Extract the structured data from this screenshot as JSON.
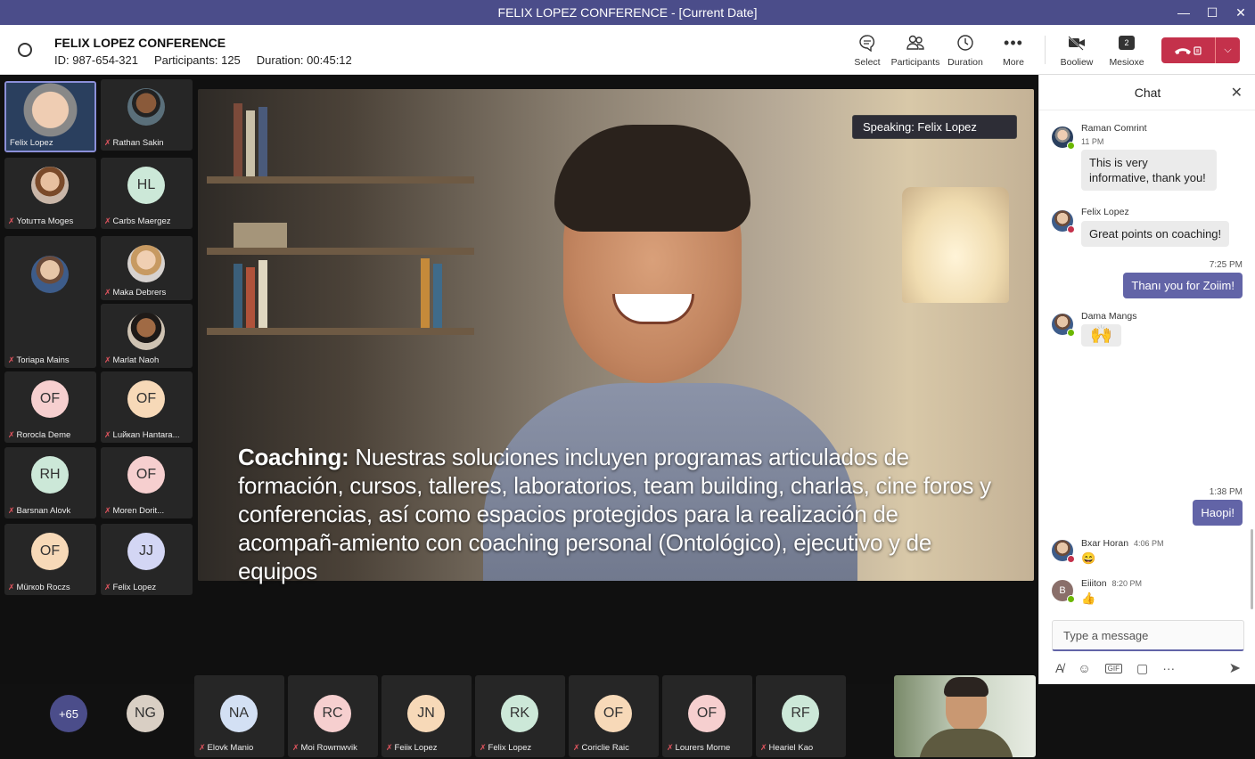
{
  "window": {
    "title": "FELIX LOPEZ CONFERENCE - [Current Date]"
  },
  "meeting": {
    "title": "FELIX LOPEZ CONFERENCE",
    "id": "ID: 987-654-321",
    "participants": "Participants: 125",
    "duration": "Duration: 00:45:12"
  },
  "toolbar": {
    "select": "Select",
    "participants": "Participants",
    "duration": "Duration",
    "more": "More",
    "booliew": "Booliew",
    "mesioxe": "Mesioxe",
    "mesioxe_badge": "2"
  },
  "speaking": "Speaking: Felix Lopez",
  "caption": {
    "lead": "Coaching:",
    "text": " Nuestras soluciones incluyen programas articulados de formación, cursos, talleres, laboratorios, team building, charlas, cine foros y conferencias, así como espacios protegidos para la realización de acompañ-amiento con coaching personal (Ontológico), ejecutivo y de equipos"
  },
  "grid": [
    {
      "name": "Felix Lopez",
      "initials": "",
      "color": "",
      "photo": "photo-av6"
    },
    {
      "name": "Rathan Sakin",
      "initials": "",
      "color": "",
      "photo": "photo-av2"
    },
    {
      "name": "Yotuтта Moges",
      "initials": "",
      "color": "",
      "photo": "photo-av3"
    },
    {
      "name": "Carbs Maergez",
      "initials": "HL",
      "color": "#cce8d8",
      "photo": ""
    },
    {
      "name": "Toriapa Mains",
      "initials": "",
      "color": "",
      "photo": "photo-av"
    },
    {
      "name": "Maka Debrers",
      "initials": "",
      "color": "",
      "photo": "photo-av4"
    },
    {
      "name": "Marlat Naoh",
      "initials": "",
      "color": "",
      "photo": "photo-av5"
    },
    {
      "name": "Rorocla Deme",
      "initials": "OF",
      "color": "#f6cfcf",
      "photo": ""
    },
    {
      "name": "Luйкan Hantara...",
      "initials": "OF",
      "color": "#f7d9b8",
      "photo": ""
    },
    {
      "name": "Barsnan Alovk",
      "initials": "RH",
      "color": "#cce8d8",
      "photo": ""
    },
    {
      "name": "Moren Dorit...",
      "initials": "OF",
      "color": "#f6cfcf",
      "photo": ""
    },
    {
      "name": "Mürкob Roczs",
      "initials": "OF",
      "color": "#f7d9b8",
      "photo": ""
    },
    {
      "name": "Felix Lopez",
      "initials": "JJ",
      "color": "#d3d6f4",
      "photo": ""
    }
  ],
  "bottom": {
    "more_count": "+65",
    "ng": "NG",
    "tiles": [
      {
        "name": "Elovk Manio",
        "initials": "NA",
        "color": "#d3e0f4"
      },
      {
        "name": "Moi Rowmwvik",
        "initials": "RC",
        "color": "#f6cfcf"
      },
      {
        "name": "Feiiк Lopez",
        "initials": "JN",
        "color": "#f7d9b8"
      },
      {
        "name": "Felix Lopez",
        "initials": "RK",
        "color": "#cce8d8"
      },
      {
        "name": "Coriclie Raic",
        "initials": "OF",
        "color": "#f7d9b8"
      },
      {
        "name": "Lourers Morne",
        "initials": "OF",
        "color": "#f6cfcf"
      },
      {
        "name": "Heariel Kao",
        "initials": "RF",
        "color": "#cce8d8"
      }
    ]
  },
  "chat": {
    "title": "Chat",
    "messages": [
      {
        "name": "Raman Comrint",
        "time": "11 PM",
        "text": "This is very informative, thank you!"
      },
      {
        "name": "Felix Lopez",
        "text": "Great points on coaching!"
      },
      {
        "time": "7:25 PM",
        "text": "Thanı you for Zoiim!"
      },
      {
        "name": "Dama Mangs",
        "text": "🙌"
      },
      {
        "time": "1:38 PM",
        "text": "Haopi!"
      },
      {
        "name": "Bxar Horan",
        "time": "4:06 PM",
        "text": "😄"
      },
      {
        "name": "Eiiiton",
        "time": "8:20 PM",
        "text": "👍",
        "initial": "B"
      }
    ],
    "placeholder": "Type a message"
  }
}
